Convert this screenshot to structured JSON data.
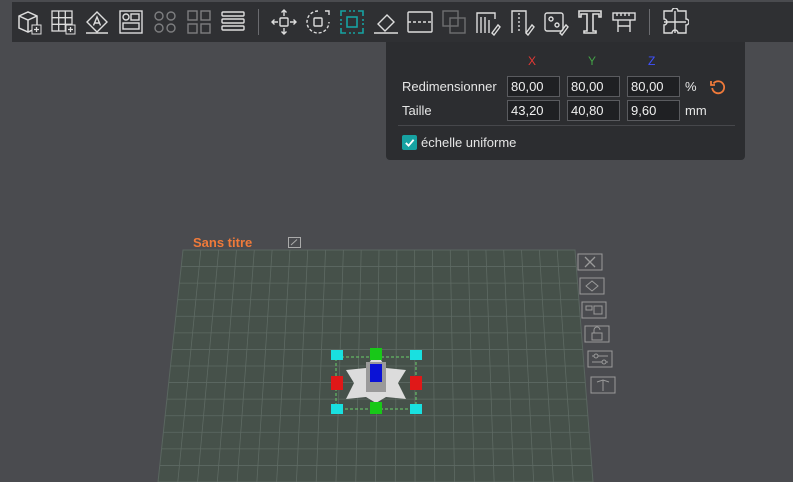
{
  "toolbar": {
    "tools": [
      {
        "name": "add-object",
        "icon": "cube-add-icon"
      },
      {
        "name": "add-plate",
        "icon": "grid-add-icon"
      },
      {
        "name": "auto-orient",
        "icon": "auto-orient-icon"
      },
      {
        "name": "arrange",
        "icon": "arrange-icon"
      },
      {
        "name": "split-objects",
        "icon": "split-objects-icon"
      },
      {
        "name": "split-parts",
        "icon": "split-parts-icon"
      },
      {
        "name": "layers",
        "icon": "layers-icon"
      },
      {
        "name": "move",
        "icon": "move-icon"
      },
      {
        "name": "rotate",
        "icon": "rotate-icon"
      },
      {
        "name": "scale",
        "icon": "scale-icon"
      },
      {
        "name": "lay-on-face",
        "icon": "lay-on-face-icon"
      },
      {
        "name": "cut",
        "icon": "cut-icon"
      },
      {
        "name": "boolean",
        "icon": "boolean-icon"
      },
      {
        "name": "support-paint",
        "icon": "support-paint-icon"
      },
      {
        "name": "seam-paint",
        "icon": "seam-paint-icon"
      },
      {
        "name": "color-paint",
        "icon": "color-paint-icon"
      },
      {
        "name": "text",
        "icon": "text-tool-icon"
      },
      {
        "name": "measure",
        "icon": "measure-icon"
      },
      {
        "name": "assembly",
        "icon": "puzzle-icon"
      }
    ]
  },
  "scale_panel": {
    "axes": {
      "x": "X",
      "y": "Y",
      "z": "Z"
    },
    "axis_colors": {
      "x": "#e53935",
      "y": "#43a047",
      "z": "#3f51ff"
    },
    "rescale_label": "Redimensionner",
    "rescale_values": {
      "x": "80,00",
      "y": "80,00",
      "z": "80,00"
    },
    "rescale_unit": "%",
    "size_label": "Taille",
    "size_values": {
      "x": "43,20",
      "y": "40,80",
      "z": "9,60"
    },
    "size_unit": "mm",
    "uniform_scale_label": "échelle uniforme",
    "uniform_scale_checked": true
  },
  "plate": {
    "title": "Sans titre",
    "title_color": "#f07a3a",
    "side_icons": [
      "close-plate-icon",
      "orient-plate-icon",
      "arrange-plate-icon",
      "lock-plate-icon",
      "plate-settings-icon",
      "move-plate-icon"
    ]
  }
}
